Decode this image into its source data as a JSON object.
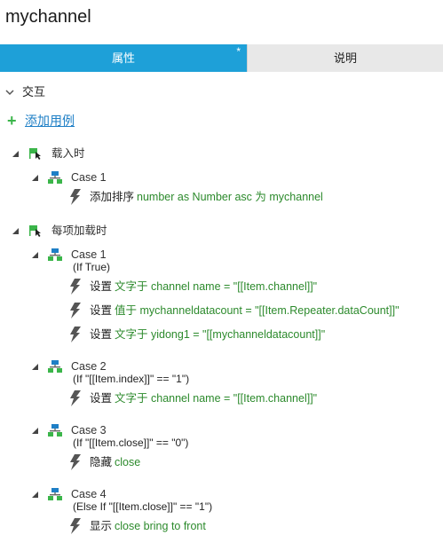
{
  "title": "mychannel",
  "tabs": {
    "properties": "属性",
    "properties_marker": "*",
    "notes": "说明"
  },
  "section": {
    "label": "交互"
  },
  "add_case": {
    "label": "添加用例"
  },
  "colors": {
    "accent": "#1ea0d8",
    "green": "#2c8a2c",
    "link": "#1e7fc6",
    "lightning": "#555555"
  },
  "events": [
    {
      "label": "载入时",
      "cases": [
        {
          "label": "Case 1",
          "condition": "",
          "actions": [
            {
              "verb": "添加排序",
              "detail": "number as Number asc 为 mychannel"
            }
          ]
        }
      ]
    },
    {
      "label": "每项加载时",
      "cases": [
        {
          "label": "Case 1",
          "condition": "(If True)",
          "actions": [
            {
              "verb": "设置",
              "detail": "文字于 channel name = \"[[Item.channel]]\""
            },
            {
              "verb": "设置",
              "detail": "值于 mychanneldatacount = \"[[Item.Repeater.dataCount]]\""
            },
            {
              "verb": "设置",
              "detail": "文字于 yidong1 = \"[[mychanneldatacount]]\""
            }
          ]
        },
        {
          "label": "Case 2",
          "condition": "(If \"[[Item.index]]\" == \"1\")",
          "actions": [
            {
              "verb": "设置",
              "detail": "文字于 channel name = \"[[Item.channel]]\""
            }
          ]
        },
        {
          "label": "Case 3",
          "condition": "(If \"[[Item.close]]\" == \"0\")",
          "actions": [
            {
              "verb": "隐藏",
              "detail": "close"
            }
          ]
        },
        {
          "label": "Case 4",
          "condition": "(Else If \"[[Item.close]]\" == \"1\")",
          "actions": [
            {
              "verb": "显示",
              "detail": "close bring to front"
            }
          ]
        }
      ]
    }
  ]
}
